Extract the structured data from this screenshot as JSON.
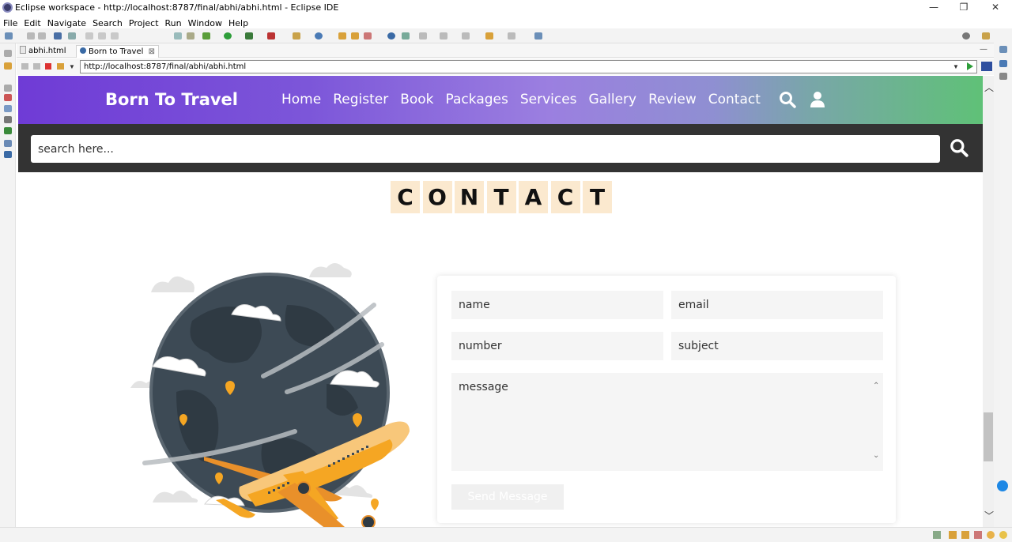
{
  "window": {
    "title": "Eclipse workspace - http://localhost:8787/final/abhi/abhi.html - Eclipse IDE",
    "minimize": "—",
    "restore": "❐",
    "close": "✕"
  },
  "menu": [
    "File",
    "Edit",
    "Navigate",
    "Search",
    "Project",
    "Run",
    "Window",
    "Help"
  ],
  "tabs": [
    {
      "label": "abhi.html",
      "icon": "html-file-icon"
    },
    {
      "label": "Born to Travel",
      "icon": "globe-icon",
      "close": "⊠"
    }
  ],
  "browser": {
    "url": "http://localhost:8787/final/abhi/abhi.html"
  },
  "site": {
    "logo": "Born To Travel",
    "nav": [
      "Home",
      "Register",
      "Book",
      "Packages",
      "Services",
      "Gallery",
      "Review",
      "Contact"
    ],
    "search_placeholder": "search here...",
    "heading_letters": [
      "C",
      "O",
      "N",
      "T",
      "A",
      "C",
      "T"
    ],
    "form": {
      "name_placeholder": "name",
      "email_placeholder": "email",
      "number_placeholder": "number",
      "subject_placeholder": "subject",
      "message_placeholder": "message",
      "send_label": "Send Message"
    }
  },
  "colors": {
    "header_gradient_start": "#6f3bd6",
    "header_gradient_end": "#5fc177",
    "search_strip": "#333333",
    "letter_tile": "#fbe9cf",
    "plane": "#f5a623",
    "globe": "#3d4a55"
  }
}
